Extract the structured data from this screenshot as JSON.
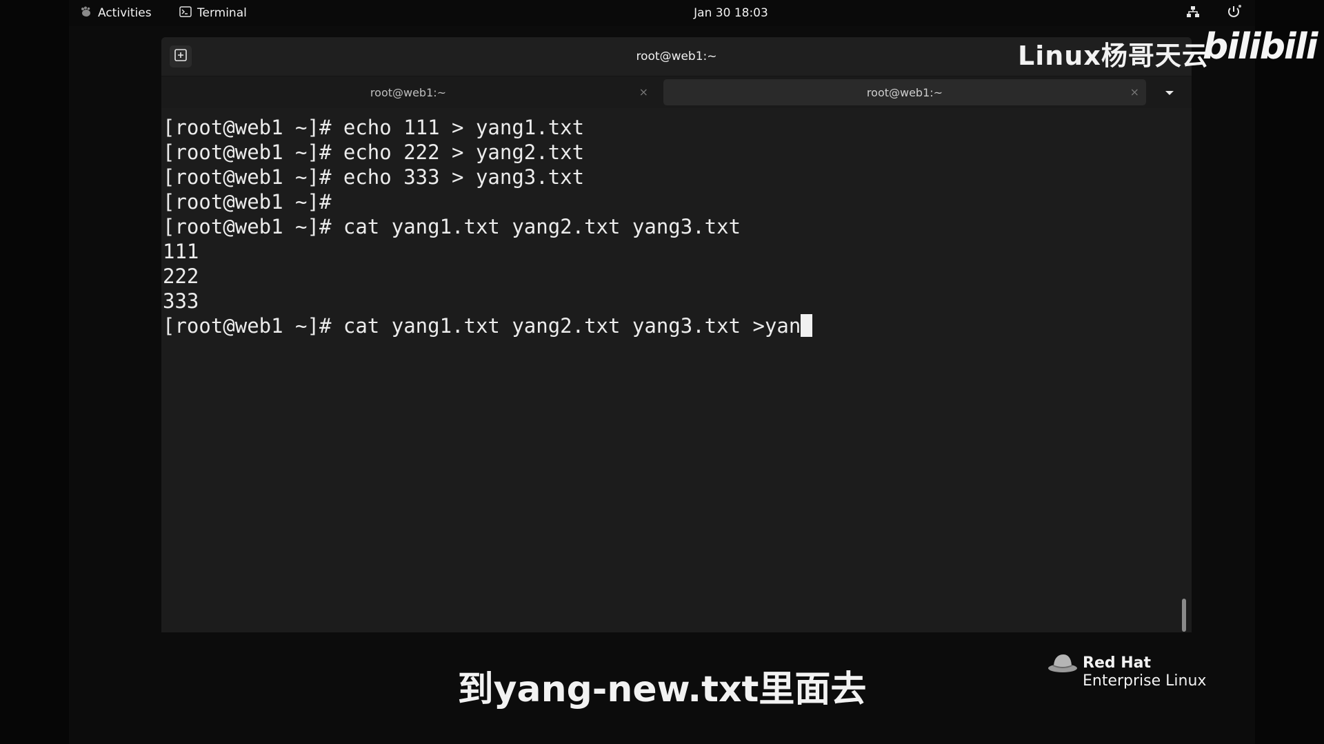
{
  "topbar": {
    "activities": "Activities",
    "app_name": "Terminal",
    "clock": "Jan 30  18:03"
  },
  "window": {
    "title": "root@web1:~",
    "tabs": [
      {
        "label": "root@web1:~",
        "active": false
      },
      {
        "label": "root@web1:~",
        "active": true
      }
    ],
    "tab_close": "×"
  },
  "terminal": {
    "lines": [
      "[root@web1 ~]# echo 111 > yang1.txt",
      "[root@web1 ~]# echo 222 > yang2.txt",
      "[root@web1 ~]# echo 333 > yang3.txt",
      "[root@web1 ~]#",
      "[root@web1 ~]# cat yang1.txt yang2.txt yang3.txt",
      "111",
      "222",
      "333",
      "[root@web1 ~]# cat yang1.txt yang2.txt yang3.txt >yan"
    ]
  },
  "watermark": {
    "text": "Linux杨哥天云",
    "logo": "bilibili"
  },
  "subtitle": "到yang-new.txt里面去",
  "branding": {
    "title": "Red Hat",
    "subtitle": "Enterprise Linux"
  },
  "colors": {
    "terminal_bg": "#1c1c1c",
    "text": "#ececec",
    "redhat": "#ee0000"
  },
  "icons": {
    "new_tab": "new-tab-icon",
    "network": "network-icon",
    "power": "power-icon",
    "dropdown": "chevron-down-icon"
  }
}
